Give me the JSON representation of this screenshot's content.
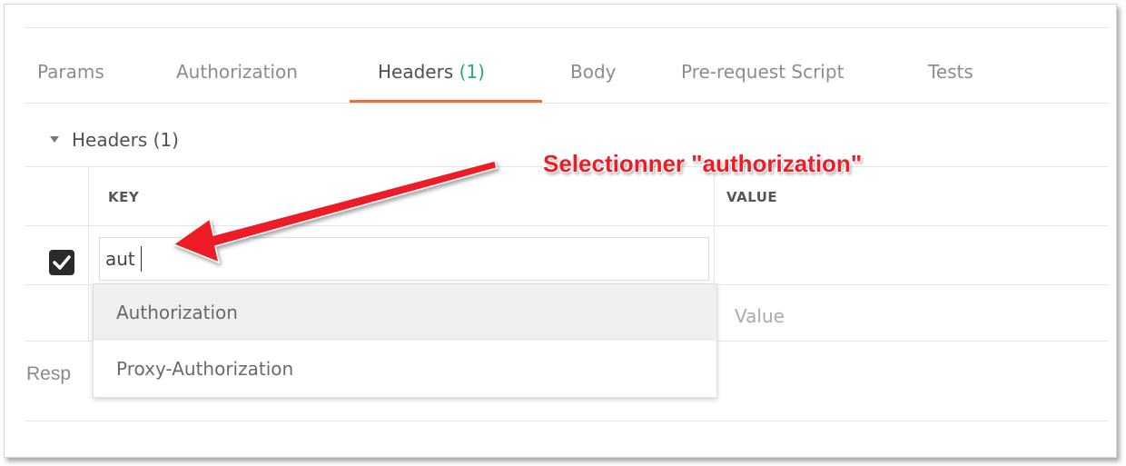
{
  "tabs": [
    {
      "label": "Params"
    },
    {
      "label": "Authorization"
    },
    {
      "label": "Headers",
      "count": "(1)"
    },
    {
      "label": "Body"
    },
    {
      "label": "Pre-request Script"
    },
    {
      "label": "Tests"
    }
  ],
  "headers_section": {
    "title": "Headers (1)",
    "columns": {
      "key": "KEY",
      "value": "VALUE"
    },
    "row": {
      "checked": true,
      "key_value": "aut"
    },
    "new_row": {
      "value_placeholder": "Value"
    }
  },
  "autocomplete": {
    "options": [
      "Authorization",
      "Proxy-Authorization"
    ],
    "highlighted_index": 0
  },
  "response_label": "Resp",
  "annotation": {
    "text": "Selectionner \"authorization\"",
    "color": "#ee1c25"
  },
  "colors": {
    "accent": "#f26b3a",
    "count_green": "#27ae60"
  }
}
